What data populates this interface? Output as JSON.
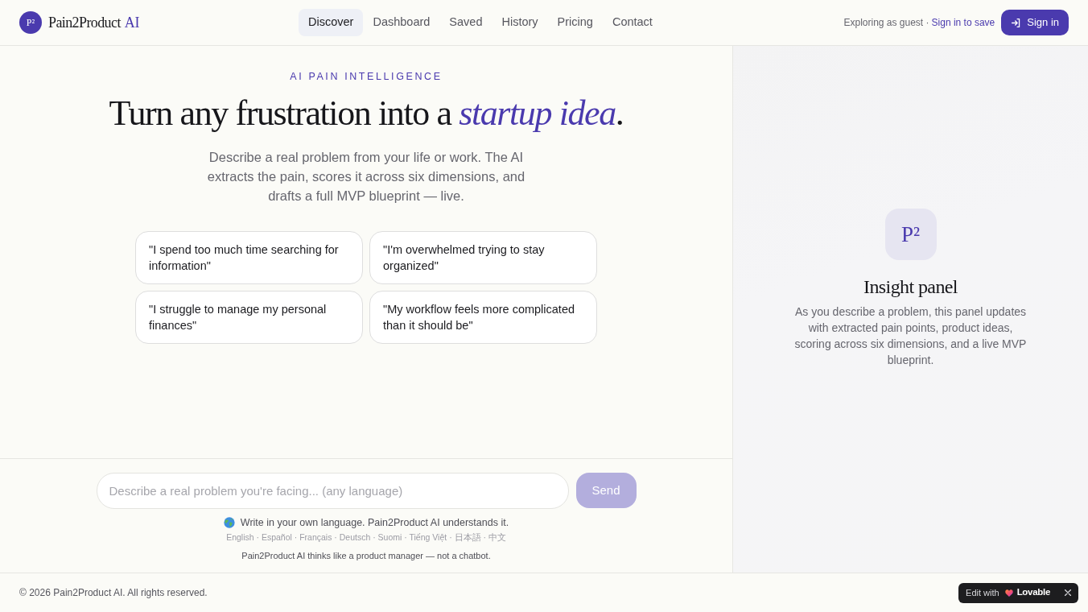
{
  "header": {
    "brand": {
      "mark": "P²",
      "name": "Pain2Product",
      "suffix": "AI"
    },
    "nav_links": [
      {
        "label": "Discover",
        "selected": true
      },
      {
        "label": "Dashboard",
        "selected": false
      },
      {
        "label": "Saved",
        "selected": false
      },
      {
        "label": "History",
        "selected": false
      },
      {
        "label": "Pricing",
        "selected": false
      },
      {
        "label": "Contact",
        "selected": false
      }
    ],
    "guest_note": "Exploring as guest ·",
    "sign_in_link": "Sign in to save",
    "sign_in_button": "Sign in"
  },
  "hero": {
    "eyebrow": "AI PAIN INTELLIGENCE",
    "headline": "Turn any frustration into a *startup idea*.",
    "intro": "Describe a real problem from your life or work. The AI extracts the pain, scores it across six dimensions, and drafts a full MVP blueprint — live."
  },
  "examples": [
    "\"I spend too much time searching for information\"",
    "\"I'm overwhelmed trying to stay organized\"",
    "\"I struggle to manage my personal finances\"",
    "\"My workflow feels more complicated than it should be\""
  ],
  "composer": {
    "placeholder": "Describe a real problem you're facing... (any language)",
    "send_button": {
      "label": "Send",
      "disabled": true
    },
    "language_note": "Write in your own language. Pain2Product AI understands it.",
    "languages": "English · Español · Français · Deutsch · Suomi · Tiếng Việt · 日本語 · 中文",
    "tagline": "Pain2Product AI thinks like a product manager — not a chatbot."
  },
  "insight_panel": {
    "mark": "P²",
    "title": "Insight panel",
    "text": "As you describe a problem, this panel updates with extracted pain points, product ideas, scoring across six dimensions, and a live MVP blueprint."
  },
  "footer": {
    "copyright": "© 2026 Pain2Product AI. All rights reserved.",
    "edit_badge": {
      "prefix": "Edit with",
      "brand": "Lovable"
    }
  }
}
